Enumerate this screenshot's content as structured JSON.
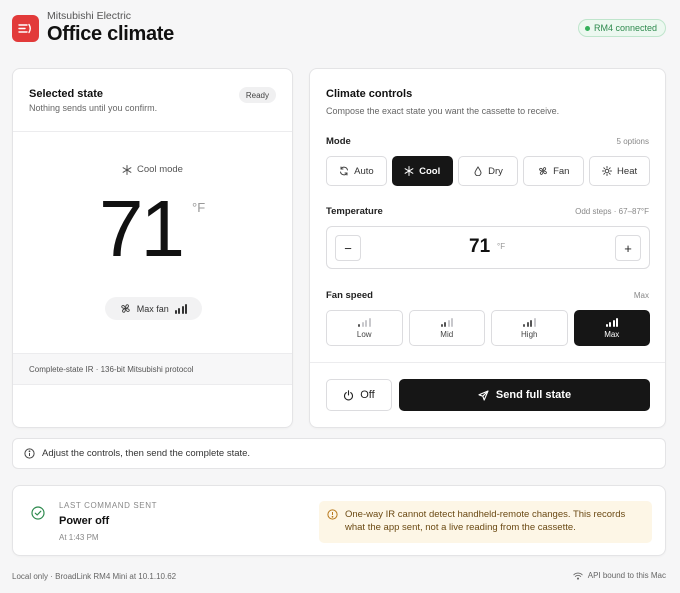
{
  "header": {
    "brand": "Mitsubishi Electric",
    "title": "Office climate",
    "connection_badge": "RM4 connected",
    "accent_color": "#e23a3a",
    "icon": "remote-signal-icon"
  },
  "selected_state": {
    "title": "Selected state",
    "subtitle": "Nothing sends until you confirm.",
    "status_badge": "Ready",
    "mode_label": "Cool mode",
    "mode_icon": "snowflake-icon",
    "temperature": "71",
    "unit": "°F",
    "fan_label": "Max fan",
    "fan_level": 4,
    "footer": "Complete-state IR · 136-bit Mitsubishi protocol"
  },
  "controls": {
    "title": "Climate controls",
    "subtitle": "Compose the exact state you want the cassette to receive.",
    "mode": {
      "label": "Mode",
      "hint": "5 options",
      "selected": "Cool",
      "options": [
        {
          "label": "Auto",
          "icon": "refresh-icon"
        },
        {
          "label": "Cool",
          "icon": "snowflake-icon"
        },
        {
          "label": "Dry",
          "icon": "droplet-icon"
        },
        {
          "label": "Fan",
          "icon": "fan-icon"
        },
        {
          "label": "Heat",
          "icon": "sun-icon"
        }
      ]
    },
    "temperature": {
      "label": "Temperature",
      "hint": "Odd steps · 67–87°F",
      "value": "71",
      "unit": "°F",
      "decrement": "−",
      "increment": "+"
    },
    "fan_speed": {
      "label": "Fan speed",
      "hint": "Max",
      "selected": "Max",
      "options": [
        {
          "label": "Low",
          "level": 1
        },
        {
          "label": "Mid",
          "level": 2
        },
        {
          "label": "High",
          "level": 3
        },
        {
          "label": "Max",
          "level": 4
        }
      ]
    },
    "off_label": "Off",
    "send_label": "Send full state"
  },
  "info_bar": "Adjust the controls, then send the complete state.",
  "last_command": {
    "label": "LAST COMMAND SENT",
    "value": "Power off",
    "time": "At 1:43 PM",
    "warning": "One-way IR cannot detect handheld-remote changes. This records what the app sent, not a live reading from the cassette."
  },
  "footer": {
    "left": "Local only · BroadLink RM4 Mini at 10.1.10.62",
    "right": "API bound to this Mac"
  }
}
